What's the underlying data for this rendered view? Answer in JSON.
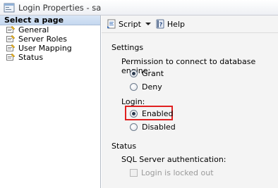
{
  "window": {
    "title": "Login Properties - sa"
  },
  "sidebar": {
    "header": "Select a page",
    "items": [
      {
        "label": "General"
      },
      {
        "label": "Server Roles"
      },
      {
        "label": "User Mapping"
      },
      {
        "label": "Status"
      }
    ]
  },
  "toolbar": {
    "script_label": "Script",
    "help_label": "Help"
  },
  "settings": {
    "heading": "Settings",
    "permission_label": "Permission to connect to database engine:",
    "permission_options": [
      {
        "label": "Grant",
        "checked": true
      },
      {
        "label": "Deny",
        "checked": false
      }
    ],
    "login_label": "Login:",
    "login_options": [
      {
        "label": "Enabled",
        "checked": true
      },
      {
        "label": "Disabled",
        "checked": false
      }
    ]
  },
  "status": {
    "heading": "Status",
    "auth_label": "SQL Server authentication:",
    "locked_out_label": "Login is locked out",
    "locked_out_checked": false
  },
  "colors": {
    "highlight": "#e02020"
  }
}
